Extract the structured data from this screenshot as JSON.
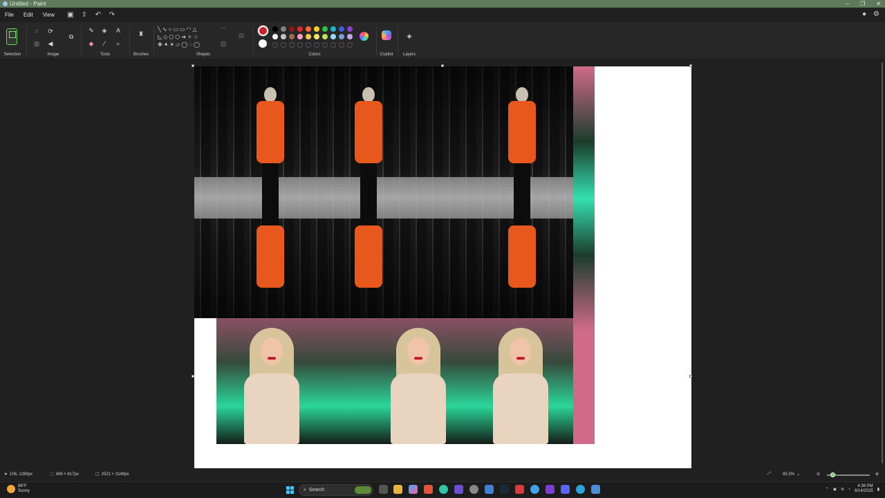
{
  "window": {
    "title": "Untitled - Paint",
    "minimize": "–",
    "restore": "❐",
    "close": "✕"
  },
  "menu": {
    "file": "File",
    "edit": "Edit",
    "view": "View"
  },
  "ribbon": {
    "groups": {
      "selection": "Selection",
      "image": "Image",
      "tools": "Tools",
      "brushes": "Brushes",
      "shapes": "Shapes",
      "colors": "Colors",
      "copilot": "Copilot",
      "layers": "Layers"
    },
    "palette_row1": [
      "#000000",
      "#7f7f7f",
      "#8b1a1a",
      "#e0252b",
      "#ff6a2b",
      "#ffd21f",
      "#2fbf4a",
      "#23b3c7",
      "#3a5fd6",
      "#8a3fd1"
    ],
    "palette_row2": [
      "#ffffff",
      "#c3c3c3",
      "#9a6b4f",
      "#ff9fbf",
      "#ffc94d",
      "#f3e36a",
      "#b9e35a",
      "#9bdcf0",
      "#7f9ed8",
      "#c3a6e3"
    ],
    "primary_color": "#d0212b",
    "secondary_color": "#ffffff"
  },
  "status": {
    "cursor_pos": "106, 1289px",
    "selection_size": "489 × 617px",
    "canvas_size": "2521 × 3149px",
    "zoom": "85.3%"
  },
  "taskbar": {
    "weather_temp": "86°F",
    "weather_desc": "Sunny",
    "search_label": "Search",
    "time": "4:38 PM",
    "date": "8/14/2025"
  }
}
